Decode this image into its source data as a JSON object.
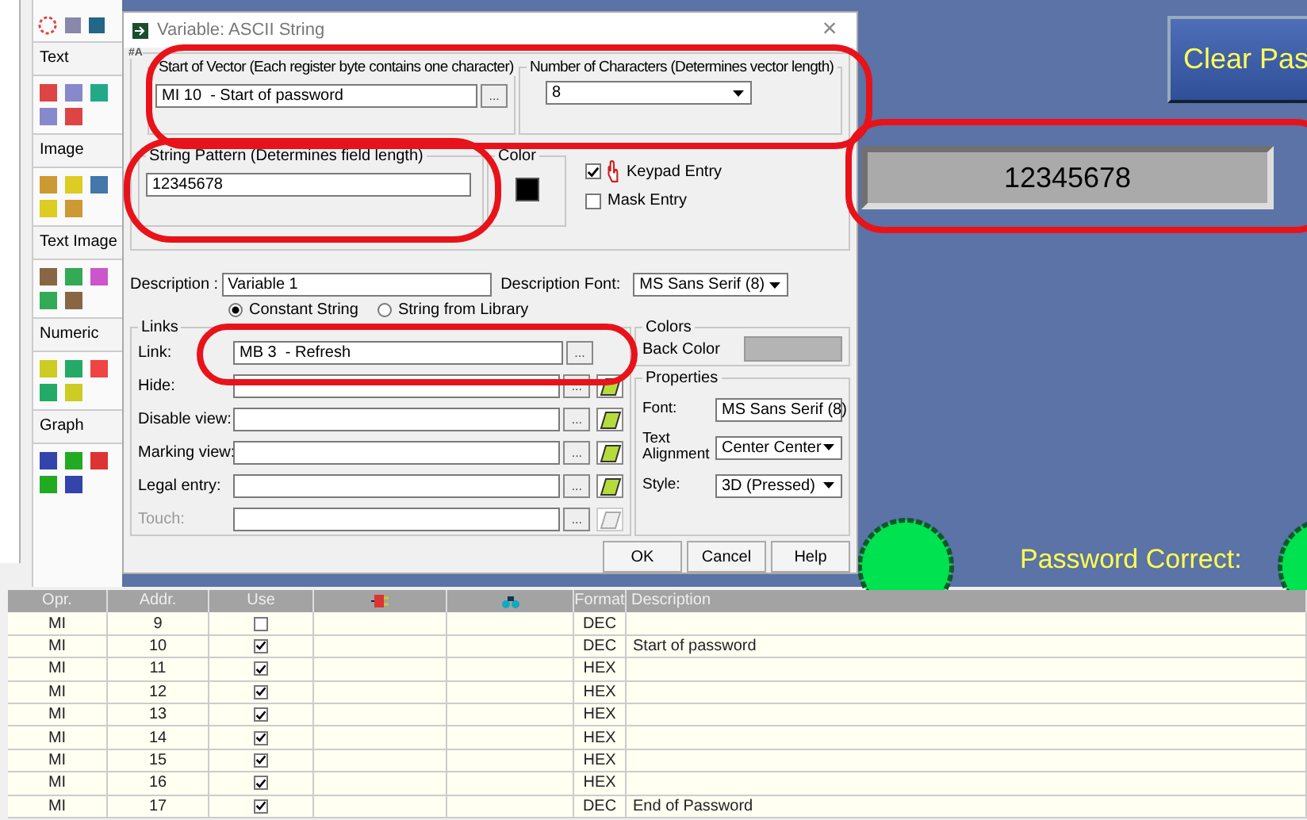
{
  "palette": {
    "sections": [
      {
        "label": "Text"
      },
      {
        "label": "Image"
      },
      {
        "label": "Text Image"
      },
      {
        "label": "Numeric"
      },
      {
        "label": "Graph"
      }
    ]
  },
  "dialog": {
    "title": "Variable: ASCII String",
    "close": "×",
    "corner_mark": "#A",
    "vector": {
      "label": "Start of Vector (Each register byte contains one character)",
      "value": "MI 10  - Start of password",
      "browse": "..."
    },
    "count": {
      "label": "Number of Characters (Determines vector length)",
      "value": "8"
    },
    "pattern": {
      "label": "String Pattern (Determines field length)",
      "value": "12345678"
    },
    "color": {
      "label": "Color",
      "color": "#000000"
    },
    "checks": [
      {
        "label": "Keypad Entry",
        "checked": true,
        "kind": "keypad"
      },
      {
        "label": "Mask Entry",
        "checked": false,
        "kind": "plain"
      }
    ],
    "description": {
      "label": "Description :",
      "value": "Variable 1",
      "font_label": "Description Font:",
      "font": "MS Sans Serif (8)"
    },
    "string_source": [
      {
        "label": "Constant String",
        "selected": true
      },
      {
        "label": "String from Library",
        "selected": false
      }
    ],
    "links": {
      "title": "Links",
      "rows": [
        {
          "label": "Link:",
          "value": "MB 3  - Refresh",
          "browse": "...",
          "eraser": false,
          "disabled": false
        },
        {
          "label": "Hide:",
          "browse": "...",
          "eraser": true,
          "disabled": false
        },
        {
          "label": "Disable view:",
          "browse": "...",
          "eraser": true,
          "disabled": false
        },
        {
          "label": "Marking view:",
          "browse": "...",
          "eraser": true,
          "disabled": false
        },
        {
          "label": "Legal entry:",
          "browse": "...",
          "eraser": true,
          "disabled": false
        },
        {
          "label": "Touch:",
          "browse": "...",
          "eraser": true,
          "disabled": true
        }
      ]
    },
    "colors": {
      "title": "Colors",
      "label": "Back Color",
      "color": "#b4b4b4"
    },
    "properties": {
      "title": "Properties",
      "rows": [
        {
          "label": "Font:",
          "value": "MS Sans Serif (8)"
        },
        {
          "label": "Text Alignment",
          "value": "Center Center"
        },
        {
          "label": "Style:",
          "value": "3D (Pressed)"
        }
      ]
    },
    "buttons": [
      "OK",
      "Cancel",
      "Help"
    ]
  },
  "canvas": {
    "clear_button": "Clear Pas",
    "display": "12345678",
    "status_label": "Password Correct:"
  },
  "table": {
    "columns": [
      {
        "label": "Opr.",
        "kind": "text"
      },
      {
        "label": "Addr.",
        "kind": "text"
      },
      {
        "label": "Use",
        "kind": "text"
      },
      {
        "kind": "plug"
      },
      {
        "kind": "binoculars"
      },
      {
        "label": "Format",
        "kind": "text"
      },
      {
        "label": "Description",
        "kind": "text"
      }
    ],
    "rows": [
      {
        "opr": "MI",
        "addr": "9",
        "use": false,
        "format": "DEC"
      },
      {
        "opr": "MI",
        "addr": "10",
        "use": true,
        "format": "DEC",
        "description": "Start of password"
      },
      {
        "opr": "MI",
        "addr": "11",
        "use": true,
        "format": "HEX"
      },
      {
        "opr": "MI",
        "addr": "12",
        "use": true,
        "format": "HEX"
      },
      {
        "opr": "MI",
        "addr": "13",
        "use": true,
        "format": "HEX"
      },
      {
        "opr": "MI",
        "addr": "14",
        "use": true,
        "format": "HEX"
      },
      {
        "opr": "MI",
        "addr": "15",
        "use": true,
        "format": "HEX"
      },
      {
        "opr": "MI",
        "addr": "16",
        "use": true,
        "format": "HEX"
      },
      {
        "opr": "MI",
        "addr": "17",
        "use": true,
        "format": "DEC",
        "description": "End of Password"
      }
    ]
  }
}
